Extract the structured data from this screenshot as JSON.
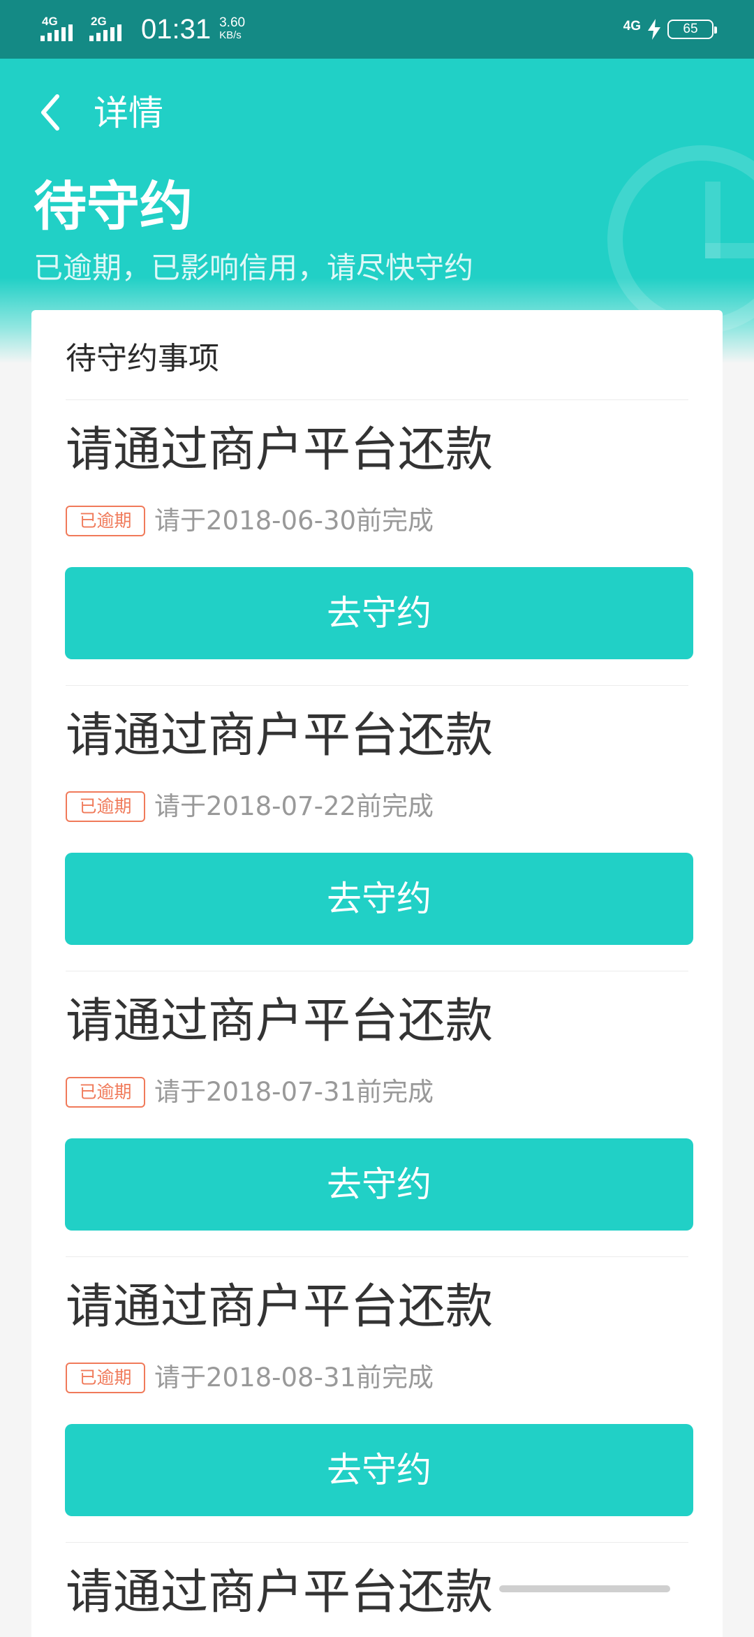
{
  "status_bar": {
    "sim1": "4G",
    "sim2": "2G",
    "time": "01:31",
    "speed_value": "3.60",
    "speed_unit": "KB/s",
    "network": "4G",
    "battery": "65"
  },
  "header": {
    "nav_title": "详情",
    "status_title": "待守约",
    "status_subtitle": "已逾期，已影响信用，请尽快守约"
  },
  "card": {
    "title": "待守约事项",
    "items": [
      {
        "title": "请通过商户平台还款",
        "badge": "已逾期",
        "due": "请于2018-06-30前完成",
        "button": "去守约"
      },
      {
        "title": "请通过商户平台还款",
        "badge": "已逾期",
        "due": "请于2018-07-22前完成",
        "button": "去守约"
      },
      {
        "title": "请通过商户平台还款",
        "badge": "已逾期",
        "due": "请于2018-07-31前完成",
        "button": "去守约"
      },
      {
        "title": "请通过商户平台还款",
        "badge": "已逾期",
        "due": "请于2018-08-31前完成",
        "button": "去守约"
      },
      {
        "title": "请通过商户平台还款"
      }
    ]
  },
  "colors": {
    "primary": "#21d0c6",
    "status_bar": "#148a85",
    "overdue": "#f07a5a"
  }
}
